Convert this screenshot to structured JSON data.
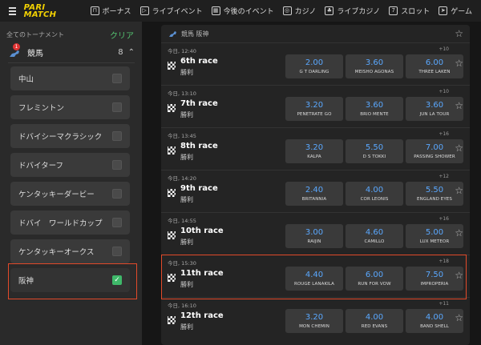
{
  "nav": {
    "logo_line1": "PARI",
    "logo_line2": "MATCH",
    "items": [
      {
        "label": "ボーナス",
        "icon": "gift-icon"
      },
      {
        "label": "ライブイベント",
        "icon": "live-icon"
      },
      {
        "label": "今後のイベント",
        "icon": "calendar-icon"
      },
      {
        "label": "カジノ",
        "icon": "casino-chip-icon"
      },
      {
        "label": "ライブカジノ",
        "icon": "live-casino-icon"
      },
      {
        "label": "スロット",
        "icon": "slot-icon"
      },
      {
        "label": "ゲーム",
        "icon": "rocket-icon"
      }
    ]
  },
  "sidebar": {
    "title": "全てのトーナメント",
    "clear": "クリア",
    "sport": {
      "name": "競馬",
      "count": "8",
      "badge": "1"
    },
    "tracks": [
      {
        "label": "中山",
        "checked": false
      },
      {
        "label": "フレミントン",
        "checked": false
      },
      {
        "label": "ドバイシーマクラシック",
        "checked": false
      },
      {
        "label": "ドバイターフ",
        "checked": false
      },
      {
        "label": "ケンタッキーダービー",
        "checked": false
      },
      {
        "label": "ドバイ　ワールドカップ",
        "checked": false
      },
      {
        "label": "ケンタッキーオークス",
        "checked": false
      },
      {
        "label": "阪神",
        "checked": true
      }
    ]
  },
  "panel": {
    "title": "競馬 阪神",
    "races": [
      {
        "time": "今日, 12:40",
        "more": "+10",
        "name": "6th race",
        "sub": "勝利",
        "odds": [
          {
            "v": "2.00",
            "n": "G T DARLING"
          },
          {
            "v": "3.60",
            "n": "MEISHO AGONAS"
          },
          {
            "v": "6.00",
            "n": "THREE LAKEN"
          }
        ]
      },
      {
        "time": "今日, 13:10",
        "more": "+10",
        "name": "7th race",
        "sub": "勝利",
        "odds": [
          {
            "v": "3.20",
            "n": "PENETRATE GO"
          },
          {
            "v": "3.60",
            "n": "BRIO MENTE"
          },
          {
            "v": "3.60",
            "n": "JUN LA TOUR"
          }
        ]
      },
      {
        "time": "今日, 13:45",
        "more": "+16",
        "name": "8th race",
        "sub": "勝利",
        "odds": [
          {
            "v": "3.20",
            "n": "KALPA"
          },
          {
            "v": "5.50",
            "n": "D S TOKKI"
          },
          {
            "v": "7.00",
            "n": "PASSING SHOWER"
          }
        ]
      },
      {
        "time": "今日, 14:20",
        "more": "+12",
        "name": "9th race",
        "sub": "勝利",
        "odds": [
          {
            "v": "2.40",
            "n": "BRITANNIA"
          },
          {
            "v": "4.00",
            "n": "COR LEONIS"
          },
          {
            "v": "5.50",
            "n": "ENGLAND EYES"
          }
        ]
      },
      {
        "time": "今日, 14:55",
        "more": "+16",
        "name": "10th race",
        "sub": "勝利",
        "odds": [
          {
            "v": "3.00",
            "n": "RAIJIN"
          },
          {
            "v": "4.60",
            "n": "CAMILLO"
          },
          {
            "v": "5.00",
            "n": "LUX METEOR"
          }
        ]
      },
      {
        "time": "今日, 15:30",
        "more": "+18",
        "name": "11th race",
        "sub": "勝利",
        "odds": [
          {
            "v": "4.40",
            "n": "ROUGE LANAKILA"
          },
          {
            "v": "6.00",
            "n": "RUN FOR VOW"
          },
          {
            "v": "7.50",
            "n": "IMPROPERIA"
          }
        ]
      },
      {
        "time": "今日, 16:10",
        "more": "+11",
        "name": "12th race",
        "sub": "勝利",
        "odds": [
          {
            "v": "3.20",
            "n": "MON CHEMIN"
          },
          {
            "v": "4.00",
            "n": "RED EVANS"
          },
          {
            "v": "4.00",
            "n": "BAND SHELL"
          }
        ]
      }
    ]
  },
  "colors": {
    "accent": "#f2d102",
    "odds": "#5aa8ff",
    "highlight": "#e24a2a",
    "check": "#3fb96a"
  }
}
